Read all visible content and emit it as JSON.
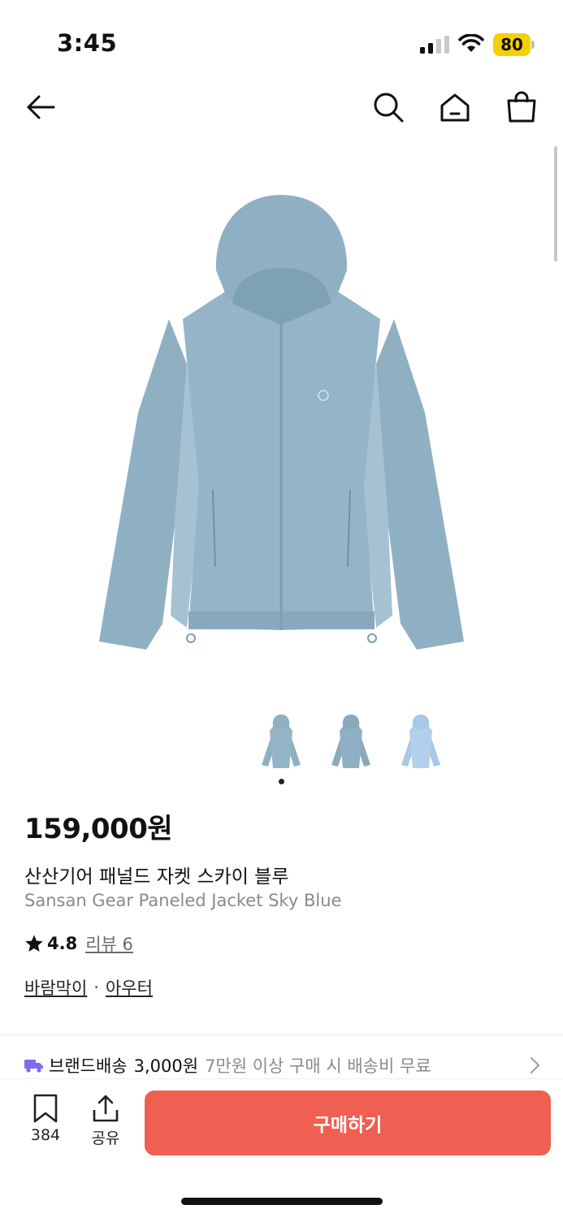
{
  "status_bar": {
    "time": "3:45",
    "battery": "80",
    "battery_color": "#f4d000"
  },
  "nav": {
    "back_icon": "arrow-left-icon",
    "search_icon": "search-icon",
    "home_icon": "home-icon",
    "cart_icon": "shopping-bag-icon"
  },
  "product": {
    "image_color": "#93b3c6",
    "thumbnail_count": 3,
    "active_thumbnail": 1,
    "price": "159,000원",
    "name_ko": "산산기어 패널드 자켓 스카이 블루",
    "name_en": "Sansan Gear Paneled Jacket Sky Blue",
    "rating": "4.8",
    "review_label": "리뷰 6",
    "categories": [
      "바람막이",
      "아우터"
    ],
    "category_separator": "·"
  },
  "shipping": {
    "icon": "truck-icon",
    "label": "브랜드배송",
    "cost": "3,000원",
    "note": "7만원 이상 구매 시 배송비 무료"
  },
  "bottom_bar": {
    "save_count": "384",
    "share_label": "공유",
    "buy_label": "구매하기",
    "buy_color": "#ef5f52"
  }
}
